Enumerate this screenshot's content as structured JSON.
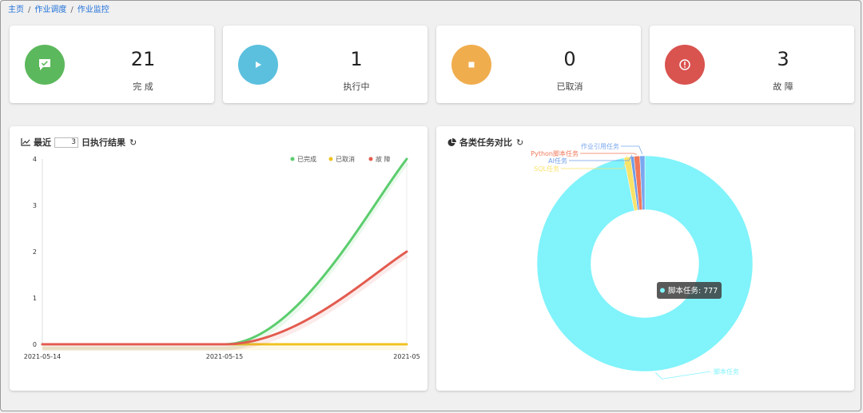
{
  "breadcrumb": {
    "items": [
      "主页",
      "作业调度",
      "作业监控"
    ]
  },
  "stats": [
    {
      "value": "21",
      "label": "完 成",
      "color": "#5cb85c",
      "icon": "chat-check-icon"
    },
    {
      "value": "1",
      "label": "执行中",
      "color": "#5bc0de",
      "icon": "play-icon"
    },
    {
      "value": "0",
      "label": "已取消",
      "color": "#f0ad4e",
      "icon": "stop-icon"
    },
    {
      "value": "3",
      "label": "故 障",
      "color": "#d9534f",
      "icon": "alert-icon"
    }
  ],
  "left_panel": {
    "title_prefix": "最近",
    "days_value": "3",
    "title_suffix": "日执行结果"
  },
  "right_panel": {
    "title": "各类任务对比"
  },
  "chart_data": [
    {
      "type": "line",
      "x": [
        "2021-05-14",
        "2021-05-15",
        "2021-05"
      ],
      "ylim": [
        0,
        4
      ],
      "yticks": [
        0,
        1,
        2,
        3,
        4
      ],
      "legend_position": "top-right",
      "series": [
        {
          "name": "已完成",
          "color": "#5ccd6e",
          "values": [
            0,
            0,
            4
          ]
        },
        {
          "name": "已取消",
          "color": "#f0c21f",
          "values": [
            0,
            0,
            0
          ]
        },
        {
          "name": "故 障",
          "color": "#e35b4f",
          "values": [
            0,
            0,
            2
          ]
        }
      ]
    },
    {
      "type": "pie",
      "inner_radius_ratio": 0.5,
      "slices": [
        {
          "name": "脚本任务",
          "value": 777,
          "color": "#80f3fb"
        },
        {
          "name": "SQL任务",
          "value": 8,
          "color": "#f8e36a"
        },
        {
          "name": "AI任务",
          "value": 4,
          "color": "#6f9ee8"
        },
        {
          "name": "Python脚本任务",
          "value": 7,
          "color": "#f0785a"
        },
        {
          "name": "作业引用任务",
          "value": 6,
          "color": "#7aa7ef"
        }
      ],
      "tooltip": {
        "label": "脚本任务: 777"
      }
    }
  ]
}
